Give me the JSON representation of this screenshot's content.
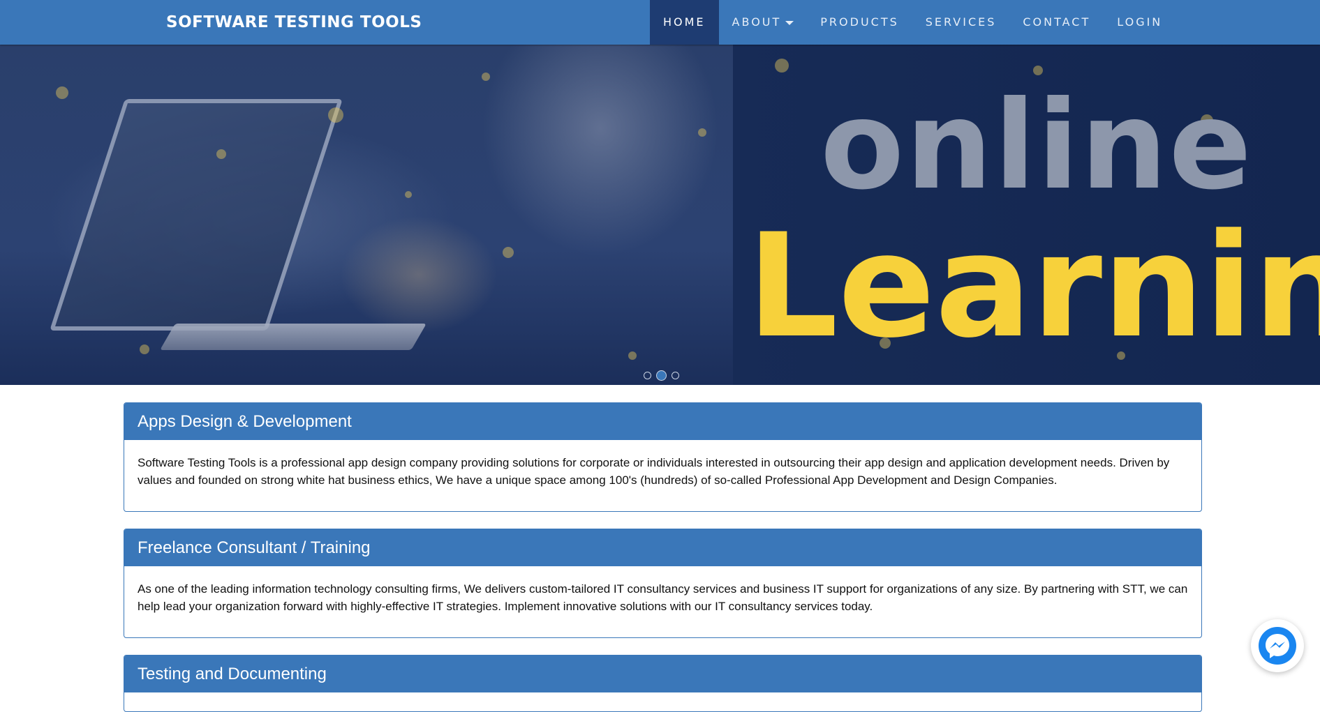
{
  "navbar": {
    "brand": "SOFTWARE TESTING TOOLS",
    "items": [
      {
        "label": "HOME",
        "active": true
      },
      {
        "label": "ABOUT",
        "dropdown": true
      },
      {
        "label": "PRODUCTS"
      },
      {
        "label": "SERVICES"
      },
      {
        "label": "CONTACT"
      },
      {
        "label": "LOGIN"
      }
    ]
  },
  "hero": {
    "line1": "online",
    "line2": "Learning",
    "carousel": {
      "slides": 3,
      "active_index": 1
    }
  },
  "panels": [
    {
      "title": "Apps Design & Development",
      "body": "Software Testing Tools is a professional app design company providing solutions for corporate or individuals interested in outsourcing their app design and application development needs. Driven by values and founded on strong white hat business ethics, We have a unique space among 100's (hundreds) of so-called Professional App Development and Design Companies."
    },
    {
      "title": "Freelance Consultant / Training",
      "body": "As one of the leading information technology consulting firms, We delivers custom-tailored IT consultancy services and business IT support for organizations of any size. By partnering with STT, we can help lead your organization forward with highly-effective IT strategies. Implement innovative solutions with our IT consultancy services today."
    },
    {
      "title": "Testing and Documenting",
      "body": ""
    }
  ],
  "messenger": {
    "icon": "messenger-icon"
  },
  "colors": {
    "primary": "#3a77b9",
    "active_nav": "#1e3c72",
    "hero_yellow": "#f7d13b",
    "hero_gray": "#8d97ab"
  }
}
